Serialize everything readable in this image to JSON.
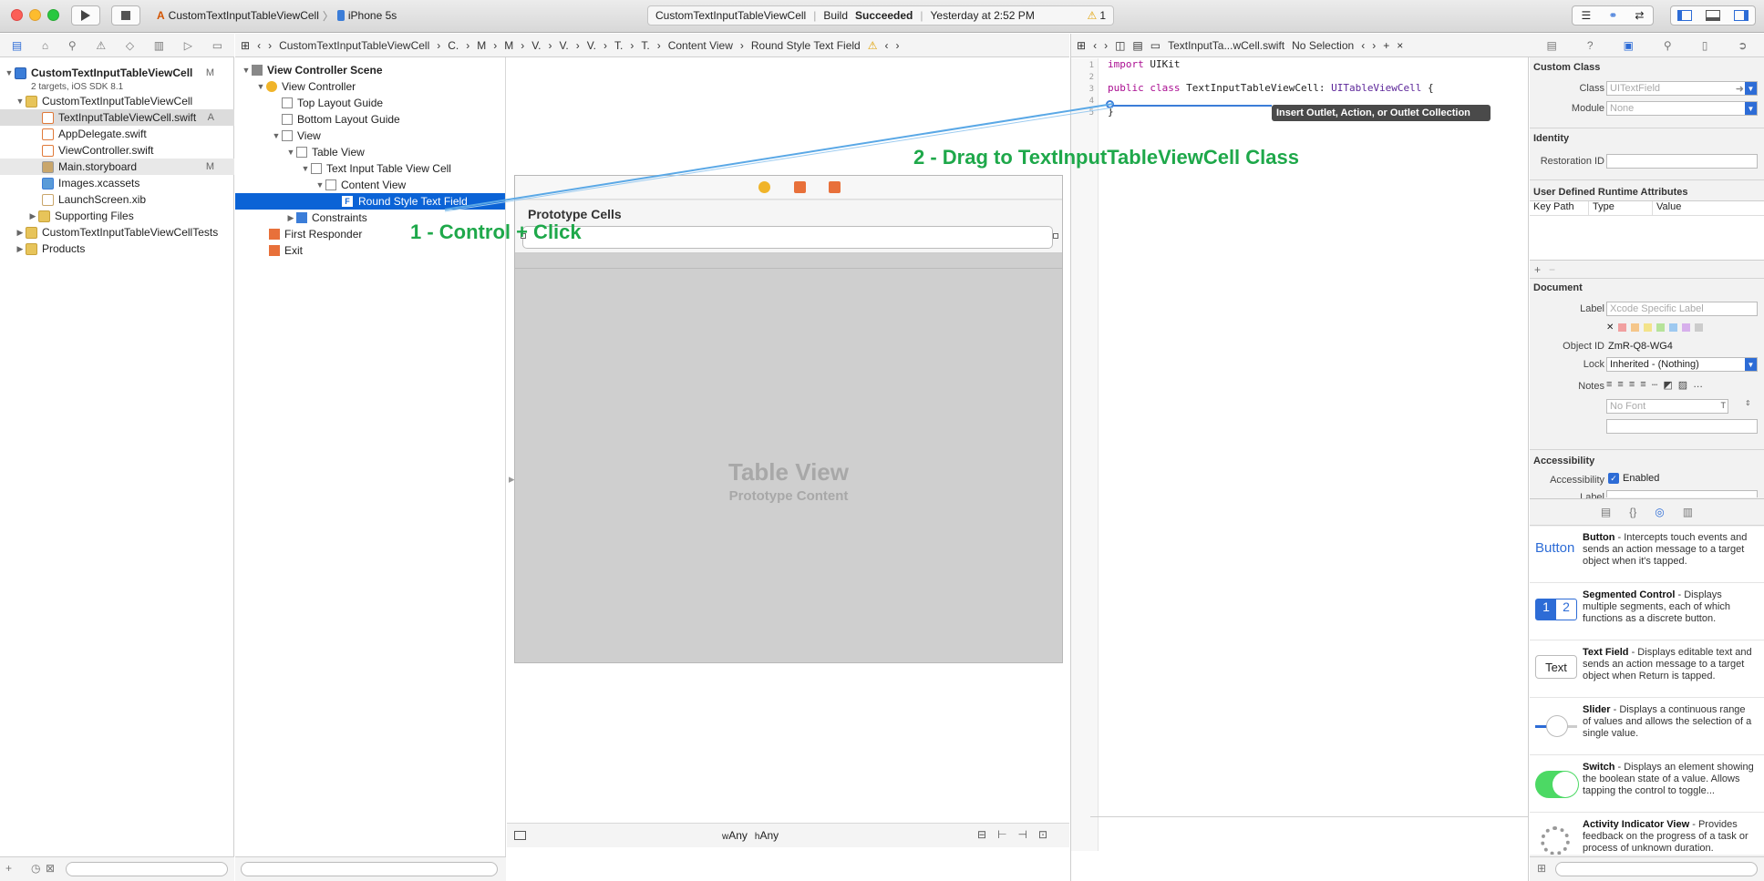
{
  "toolbar": {
    "scheme": "CustomTextInputTableViewCell",
    "device": "iPhone 5s",
    "status_project": "CustomTextInputTableViewCell",
    "status_label": "Build",
    "status_value": "Succeeded",
    "status_time": "Yesterday at 2:52 PM",
    "warnings": "1"
  },
  "navigator": {
    "items": [
      {
        "label": "CustomTextInputTableViewCell",
        "badge": "M",
        "sub": "2 targets, iOS SDK 8.1"
      },
      {
        "label": "CustomTextInputTableViewCell",
        "badge": ""
      },
      {
        "label": "TextInputTableViewCell.swift",
        "badge": "A"
      },
      {
        "label": "AppDelegate.swift",
        "badge": ""
      },
      {
        "label": "ViewController.swift",
        "badge": ""
      },
      {
        "label": "Main.storyboard",
        "badge": "M"
      },
      {
        "label": "Images.xcassets",
        "badge": ""
      },
      {
        "label": "LaunchScreen.xib",
        "badge": ""
      },
      {
        "label": "Supporting Files",
        "badge": ""
      },
      {
        "label": "CustomTextInputTableViewCellTests",
        "badge": ""
      },
      {
        "label": "Products",
        "badge": ""
      }
    ]
  },
  "ib_jumpbar": {
    "crumbs": [
      "CustomTextInputTableViewCell",
      "C.",
      "M",
      "M",
      "V.",
      "V.",
      "V.",
      "T.",
      "T.",
      "Content View",
      "Round Style Text Field"
    ]
  },
  "outline": {
    "items": [
      "View Controller Scene",
      "View Controller",
      "Top Layout Guide",
      "Bottom Layout Guide",
      "View",
      "Table View",
      "Text Input Table View Cell",
      "Content View",
      "Round Style Text Field",
      "Constraints",
      "First Responder",
      "Exit"
    ]
  },
  "canvas": {
    "prototype_cells": "Prototype Cells",
    "table_view": "Table View",
    "prototype_content": "Prototype Content",
    "size_w": "Any",
    "size_h": "Any",
    "size_w_prefix": "w",
    "size_h_prefix": "h"
  },
  "editor": {
    "jumpbar_file": "TextInputTa...wCell.swift",
    "jumpbar_sel": "No Selection",
    "line_numbers": [
      "1",
      "2",
      "3",
      "4",
      "5"
    ],
    "code": {
      "kw_import": "import",
      "mod": "UIKit",
      "kw_public": "public",
      "kw_class": "class",
      "class_name": "TextInputTableViewCell",
      "colon": ":",
      "super": "UITableViewCell",
      "brace": "{",
      "close": "}"
    },
    "tooltip": "Insert Outlet, Action, or Outlet Collection"
  },
  "annotations": {
    "step1": "1 -  Control + Click",
    "step2": "2 - Drag to TextInputTableViewCell Class"
  },
  "inspector": {
    "custom_class": "Custom Class",
    "class_label": "Class",
    "class_ph": "UITextField",
    "module_label": "Module",
    "module_ph": "None",
    "identity": "Identity",
    "restoration_label": "Restoration ID",
    "udra": "User Defined Runtime Attributes",
    "col_key": "Key Path",
    "col_type": "Type",
    "col_value": "Value",
    "document": "Document",
    "label_label": "Label",
    "label_ph": "Xcode Specific Label",
    "objid_label": "Object ID",
    "objid": "ZmR-Q8-WG4",
    "lock_label": "Lock",
    "lock_value": "Inherited - (Nothing)",
    "notes_label": "Notes",
    "font_ph": "No Font",
    "accessibility": "Accessibility",
    "acc_label": "Accessibility",
    "acc_enabled": "Enabled",
    "acc_label2": "Label"
  },
  "library": {
    "items": [
      {
        "name": "Button",
        "desc": " - Intercepts touch events and sends an action message to a target object when it's tapped.",
        "icon_text": "Button"
      },
      {
        "name": "Segmented Control",
        "desc": " - Displays multiple segments, each of which functions as a discrete button.",
        "icon_text": "1 2"
      },
      {
        "name": "Text Field",
        "desc": " - Displays editable text and sends an action message to a target object when Return is tapped.",
        "icon_text": "Text"
      },
      {
        "name": "Slider",
        "desc": " - Displays a continuous range of values and allows the selection of a single value.",
        "icon_text": ""
      },
      {
        "name": "Switch",
        "desc": " - Displays an element showing the boolean state of a value. Allows tapping the control to toggle...",
        "icon_text": ""
      },
      {
        "name": "Activity Indicator View",
        "desc": " - Provides feedback on the progress of a task or process of unknown duration.",
        "icon_text": ""
      }
    ]
  },
  "colors": {
    "selection": "#0b63d6",
    "keyword": "#aa0d91",
    "type": "#5c2699",
    "annotation": "#1ea84a",
    "connection": "#5aa8e6"
  }
}
